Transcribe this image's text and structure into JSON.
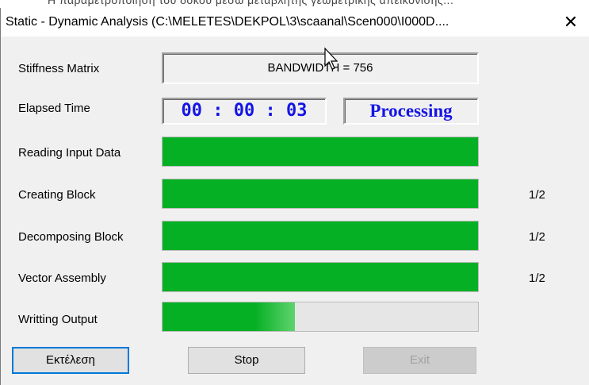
{
  "background_strip": "Η παραμετροποίηση του δοκού μέσω μεταβλητής γεωμετρικής απεικόνισης...",
  "window": {
    "title": "Static - Dynamic Analysis (C:\\MELETES\\DEKPOL\\3\\scaanal\\Scen000\\I000D....",
    "close_glyph": "✕"
  },
  "stiffness": {
    "label": "Stiffness Matrix",
    "value": "BANDWIDTH = 756"
  },
  "elapsed": {
    "label": "Elapsed Time",
    "time": "00 : 00 : 03",
    "status": "Processing"
  },
  "tasks": [
    {
      "label": "Reading Input Data",
      "progress": 1.0,
      "count": ""
    },
    {
      "label": "Creating Block",
      "progress": 1.0,
      "count": "1/2"
    },
    {
      "label": "Decomposing Block",
      "progress": 1.0,
      "count": "1/2"
    },
    {
      "label": "Vector Assembly",
      "progress": 1.0,
      "count": "1/2"
    },
    {
      "label": "Writting Output",
      "progress": 0.42,
      "count": ""
    }
  ],
  "buttons": {
    "run": "Εκτέλεση",
    "stop": "Stop",
    "exit": "Exit"
  },
  "colors": {
    "progress_green": "#06b025",
    "accent_blue": "#1515e6",
    "focus_blue": "#0078d7"
  }
}
